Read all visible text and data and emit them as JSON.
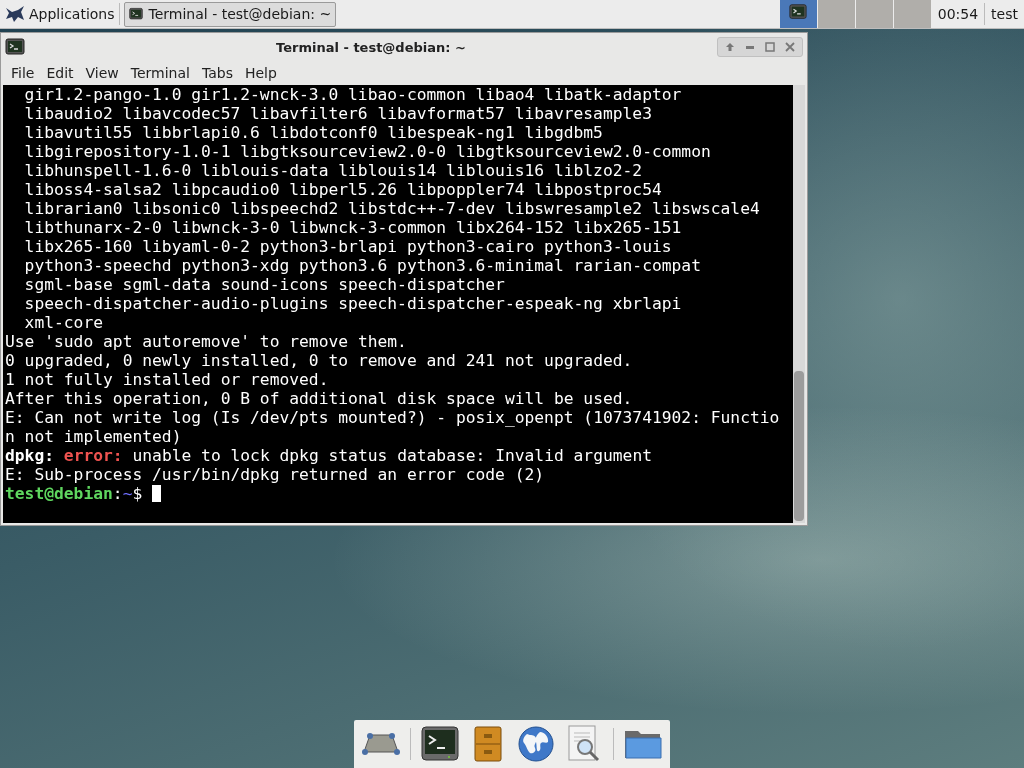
{
  "top_panel": {
    "applications": "Applications",
    "tasks": [
      {
        "label": "Terminal - test@debian: ~",
        "selected": true
      }
    ],
    "workspaces": [
      {
        "selected": true
      },
      {
        "selected": false
      },
      {
        "selected": false
      },
      {
        "selected": false
      }
    ],
    "clock": "00:54",
    "user": "test"
  },
  "window": {
    "title": "Terminal - test@debian: ~",
    "menu": [
      "File",
      "Edit",
      "View",
      "Terminal",
      "Tabs",
      "Help"
    ],
    "lines": [
      {
        "indent": true,
        "segments": [
          {
            "text": "gir1.2-pango-1.0 gir1.2-wnck-3.0 libao-common libao4 libatk-adaptor",
            "kind": "plain"
          }
        ]
      },
      {
        "indent": true,
        "segments": [
          {
            "text": "libaudio2 libavcodec57 libavfilter6 libavformat57 libavresample3",
            "kind": "plain"
          }
        ]
      },
      {
        "indent": true,
        "segments": [
          {
            "text": "libavutil55 libbrlapi0.6 libdotconf0 libespeak-ng1 libgdbm5",
            "kind": "plain"
          }
        ]
      },
      {
        "indent": true,
        "segments": [
          {
            "text": "libgirepository-1.0-1 libgtksourceview2.0-0 libgtksourceview2.0-common",
            "kind": "plain"
          }
        ]
      },
      {
        "indent": true,
        "segments": [
          {
            "text": "libhunspell-1.6-0 liblouis-data liblouis14 liblouis16 liblzo2-2",
            "kind": "plain"
          }
        ]
      },
      {
        "indent": true,
        "segments": [
          {
            "text": "liboss4-salsa2 libpcaudio0 libperl5.26 libpoppler74 libpostproc54",
            "kind": "plain"
          }
        ]
      },
      {
        "indent": true,
        "segments": [
          {
            "text": "librarian0 libsonic0 libspeechd2 libstdc++-7-dev libswresample2 libswscale4",
            "kind": "plain"
          }
        ]
      },
      {
        "indent": true,
        "segments": [
          {
            "text": "libthunarx-2-0 libwnck-3-0 libwnck-3-common libx264-152 libx265-151",
            "kind": "plain"
          }
        ]
      },
      {
        "indent": true,
        "segments": [
          {
            "text": "libx265-160 libyaml-0-2 python3-brlapi python3-cairo python3-louis",
            "kind": "plain"
          }
        ]
      },
      {
        "indent": true,
        "segments": [
          {
            "text": "python3-speechd python3-xdg python3.6 python3.6-minimal rarian-compat",
            "kind": "plain"
          }
        ]
      },
      {
        "indent": true,
        "segments": [
          {
            "text": "sgml-base sgml-data sound-icons speech-dispatcher",
            "kind": "plain"
          }
        ]
      },
      {
        "indent": true,
        "segments": [
          {
            "text": "speech-dispatcher-audio-plugins speech-dispatcher-espeak-ng xbrlapi",
            "kind": "plain"
          }
        ]
      },
      {
        "indent": true,
        "segments": [
          {
            "text": "xml-core",
            "kind": "plain"
          }
        ]
      },
      {
        "indent": false,
        "segments": [
          {
            "text": "Use 'sudo apt autoremove' to remove them.",
            "kind": "plain"
          }
        ]
      },
      {
        "indent": false,
        "segments": [
          {
            "text": "0 upgraded, 0 newly installed, 0 to remove and 241 not upgraded.",
            "kind": "plain"
          }
        ]
      },
      {
        "indent": false,
        "segments": [
          {
            "text": "1 not fully installed or removed.",
            "kind": "plain"
          }
        ]
      },
      {
        "indent": false,
        "segments": [
          {
            "text": "After this operation, 0 B of additional disk space will be used.",
            "kind": "plain"
          }
        ]
      },
      {
        "indent": false,
        "segments": [
          {
            "text": "E: Can not write log (Is /dev/pts mounted?) - posix_openpt (1073741902: Functio",
            "kind": "plain"
          }
        ]
      },
      {
        "indent": false,
        "segments": [
          {
            "text": "n not implemented)",
            "kind": "plain"
          }
        ]
      },
      {
        "indent": false,
        "segments": [
          {
            "text": "dpkg:",
            "kind": "bold"
          },
          {
            "text": "error:",
            "kind": "error"
          },
          {
            "text": "unable to lock dpkg status database: Invalid argument",
            "kind": "plain"
          }
        ]
      },
      {
        "indent": false,
        "segments": [
          {
            "text": "E: Sub-process /usr/bin/dpkg returned an error code (2)",
            "kind": "plain"
          }
        ]
      },
      {
        "indent": false,
        "cursor": true,
        "segments": [
          {
            "text": "test@debian",
            "kind": "user"
          },
          {
            "text": ":",
            "kind": "plain"
          },
          {
            "text": "~",
            "kind": "path"
          },
          {
            "text": "$",
            "kind": "plain"
          }
        ]
      }
    ]
  },
  "dock": [
    {
      "kind": "desktop"
    },
    {
      "kind": "separator"
    },
    {
      "kind": "terminal"
    },
    {
      "kind": "files"
    },
    {
      "kind": "browser"
    },
    {
      "kind": "search"
    },
    {
      "kind": "separator"
    },
    {
      "kind": "folder"
    }
  ]
}
